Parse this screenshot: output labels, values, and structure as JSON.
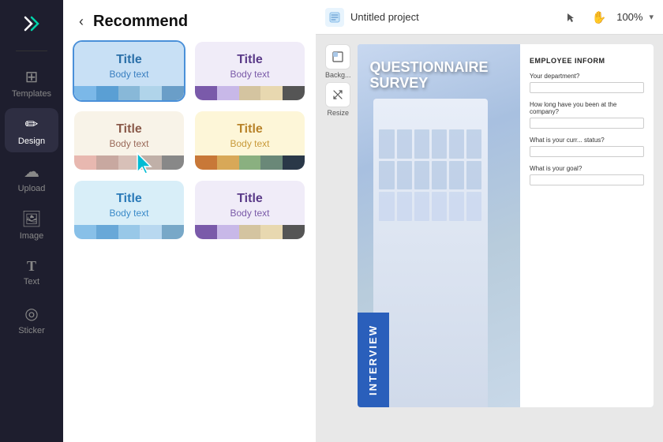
{
  "app": {
    "logo": "✂",
    "title": "Recommend"
  },
  "sidebar": {
    "items": [
      {
        "id": "templates",
        "label": "Templates",
        "icon": "⊞",
        "active": false
      },
      {
        "id": "design",
        "label": "Design",
        "icon": "✏",
        "active": true
      },
      {
        "id": "upload",
        "label": "Upload",
        "icon": "☁",
        "active": false
      },
      {
        "id": "image",
        "label": "Image",
        "icon": "🖼",
        "active": false
      },
      {
        "id": "text",
        "label": "Text",
        "icon": "T",
        "active": false
      },
      {
        "id": "sticker",
        "label": "Sticker",
        "icon": "◎",
        "active": false
      }
    ]
  },
  "panel": {
    "back_label": "‹",
    "title": "Recommend",
    "templates": [
      {
        "id": "tpl-1",
        "title": "Title",
        "body": "Body text",
        "style": "blue",
        "colors": [
          "#7bb8e8",
          "#5a9fd4",
          "#88b8d8",
          "#b0d4ea",
          "#6a9ec8"
        ],
        "selected": true
      },
      {
        "id": "tpl-2",
        "title": "Title",
        "body": "Body text",
        "style": "light",
        "colors": [
          "#7a5aaa",
          "#c8b8e8",
          "#d4c4a0",
          "#e8d8b0",
          "#555"
        ]
      },
      {
        "id": "tpl-3",
        "title": "Title",
        "body": "Body text",
        "style": "cream",
        "colors": [
          "#e8b8b0",
          "#c8a8a0",
          "#d8c0b8",
          "#c0b0a8",
          "#888"
        ]
      },
      {
        "id": "tpl-4",
        "title": "Title",
        "body": "Body text",
        "style": "yellow",
        "colors": [
          "#c87838",
          "#d8a858",
          "#8ab080",
          "#6a8878",
          "#2a3848"
        ]
      },
      {
        "id": "tpl-5",
        "title": "Title",
        "body": "Body text",
        "style": "lightblue",
        "colors": [
          "#88c0e8",
          "#68a8d8",
          "#98c8e8",
          "#b8d8f0",
          "#78a8c8"
        ]
      },
      {
        "id": "tpl-6",
        "title": "Title",
        "body": "Body text",
        "style": "purple-light",
        "colors": [
          "#7a5aaa",
          "#c8b8e8",
          "#d4c4a0",
          "#e8d8b0",
          "#555"
        ]
      }
    ]
  },
  "canvas": {
    "project_name": "Untitled project",
    "zoom": "100%",
    "tools": [
      {
        "id": "background",
        "label": "Backg...",
        "icon": "⬚"
      },
      {
        "id": "resize",
        "label": "Resize",
        "icon": "⤢"
      }
    ],
    "document": {
      "headline": "QUESTIONNAIRE\nSURVEY",
      "interview_label": "INTERVIEW",
      "section_title": "EMPLOYEE INFORM",
      "questions": [
        {
          "label": "Your department?"
        },
        {
          "label": "How long have you been at the company?"
        },
        {
          "label": "What is your curr... status?"
        },
        {
          "label": "What is your goal?"
        }
      ]
    }
  }
}
